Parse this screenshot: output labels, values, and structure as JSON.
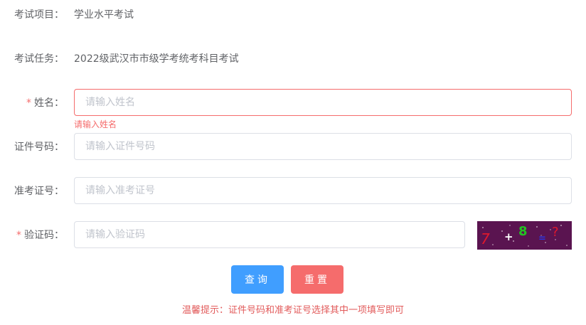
{
  "info": {
    "subject_label": "考试项目：",
    "subject_value": "学业水平考试",
    "task_label": "考试任务：",
    "task_value": "2022级武汉市市级学考统考科目考试"
  },
  "form": {
    "required_mark": "*",
    "name_label": "姓名：",
    "name_placeholder": "请输入姓名",
    "name_value": "",
    "name_error": "请输入姓名",
    "idcard_label": "证件号码：",
    "idcard_placeholder": "请输入证件号码",
    "idcard_value": "",
    "ticket_label": "准考证号：",
    "ticket_placeholder": "请输入准考证号",
    "ticket_value": "",
    "captcha_label": "验证码：",
    "captcha_placeholder": "请输入验证码",
    "captcha_value": ""
  },
  "captcha_image": {
    "chars": [
      "7",
      "+",
      "8",
      "=",
      "?"
    ],
    "char_colors": [
      "#e0182c",
      "#ffffff",
      "#22c322",
      "#2a35e0",
      "#e0182c"
    ],
    "background": "#5a1450"
  },
  "buttons": {
    "query_label": "查询",
    "query_color": "#409eff",
    "reset_label": "重置",
    "reset_color": "#f56c6c"
  },
  "tip": "温馨提示：证件号码和准考证号选择其中一项填写即可"
}
